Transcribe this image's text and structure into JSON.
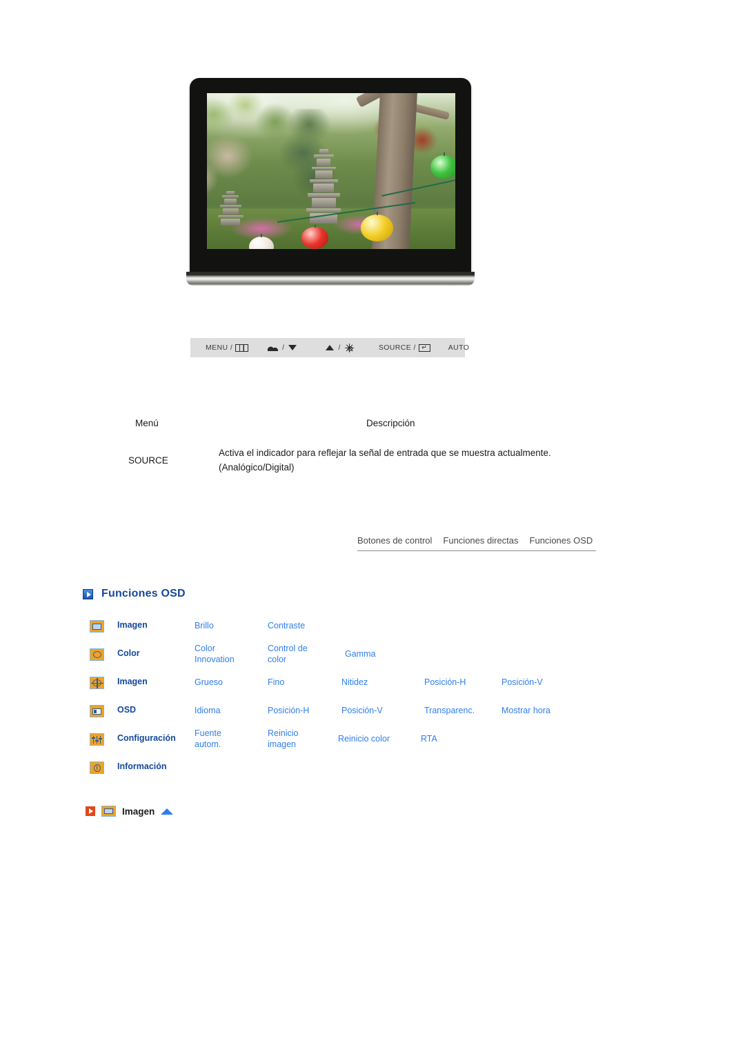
{
  "monitor": {
    "power_button_icon": "power-icon",
    "screen_photo_alt": "Korean garden with stone pagoda, trees and paper lanterns"
  },
  "control_strip": {
    "buttons": [
      {
        "label": "MENU /",
        "icon": "menu-grid-icon",
        "name": "menu-button"
      },
      {
        "label": "/",
        "icon": "mountain-icon",
        "icon2": "triangle-down-icon",
        "name": "down-button"
      },
      {
        "label": "/",
        "icon": "triangle-up-icon",
        "icon2": "brightness-sun-icon",
        "name": "up-brightness-button"
      },
      {
        "label": "SOURCE /",
        "icon": "enter-icon",
        "name": "source-enter-button"
      },
      {
        "label": "AUTO",
        "icon": "",
        "name": "auto-button"
      }
    ]
  },
  "desc_table": {
    "headers": {
      "menu": "Menú",
      "description": "Descripción"
    },
    "rows": [
      {
        "menu": "SOURCE",
        "description": "Activa el indicador para reflejar la señal de entrada que se muestra actualmente. (Analógico/Digital)"
      }
    ]
  },
  "tabs": [
    {
      "label": "Botones de control",
      "name": "tab-botones-de-control"
    },
    {
      "label": "Funciones directas",
      "name": "tab-funciones-directas"
    },
    {
      "label": "Funciones OSD",
      "name": "tab-funciones-osd"
    }
  ],
  "section": {
    "heading": "Funciones OSD",
    "bullet_icon": "blue-play-square-icon"
  },
  "osd_table": {
    "rows": [
      {
        "icon": "picture-icon",
        "category": "Imagen",
        "items": [
          "Brillo",
          "Contraste"
        ]
      },
      {
        "icon": "color-palette-icon",
        "category": "Color",
        "items": [
          "Color\nInnovation",
          "Control de\ncolor",
          "Gamma"
        ]
      },
      {
        "icon": "geometry-icon",
        "category": "Imagen",
        "items": [
          "Grueso",
          "Fino",
          "Nitidez",
          "Posición-H",
          "Posición-V"
        ]
      },
      {
        "icon": "osd-window-icon",
        "category": "OSD",
        "items": [
          "Idioma",
          "Posición-H",
          "Posición-V",
          "Transparenc.",
          "Mostrar hora"
        ]
      },
      {
        "icon": "sliders-icon",
        "category": "Configuración",
        "items": [
          "Fuente\nautom.",
          "Reinicio\nimagen",
          "Reinicio color",
          "RTA"
        ]
      },
      {
        "icon": "information-icon",
        "category": "Información",
        "items": []
      }
    ]
  },
  "imagen_section": {
    "bullet_icon": "orange-play-square-icon",
    "menu_icon": "picture-icon",
    "title": "Imagen",
    "back_to_top_icon": "triangle-up-icon"
  },
  "colors": {
    "heading_blue": "#14489e",
    "link_blue": "#2f7eed",
    "icon_orange": "#f0a323",
    "bullet_orange": "#e2481c",
    "strip_gray": "#dedede"
  }
}
